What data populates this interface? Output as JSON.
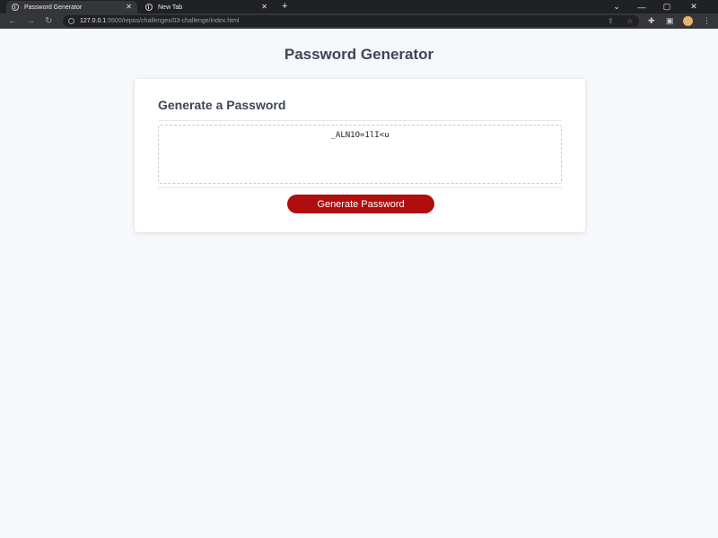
{
  "browser": {
    "tabs": [
      {
        "title": "Password Generator",
        "active": true
      },
      {
        "title": "New Tab",
        "active": false
      }
    ],
    "new_tab_symbol": "+",
    "close_symbol": "✕",
    "url": {
      "host": "127.0.0.1",
      "path": ":5500/repos/challenges/03-challenge/index.html"
    },
    "window_controls": [
      "—",
      "▢",
      "✕"
    ]
  },
  "page": {
    "title": "Password Generator",
    "card": {
      "header": "Generate a Password",
      "password_value": "_ALN1O=1lI<u",
      "button_label": "Generate Password"
    }
  },
  "colors": {
    "accent": "#b00e0e",
    "background": "#f6f8fb",
    "title_text": "#3d4656"
  }
}
